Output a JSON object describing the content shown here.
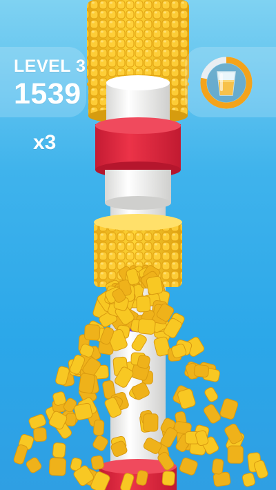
{
  "hud": {
    "level_label": "LEVEL 3",
    "score": "1539",
    "multiplier": "x3"
  },
  "juice_meter": {
    "icon": "juice-glass-icon",
    "fill_fraction": 0.78,
    "ring_color": "#f3a31b",
    "track_color": "#e9eef2"
  },
  "colors": {
    "sky_top": "#7fd2f2",
    "sky_bottom": "#2f9fe3",
    "corn": "#f6c21c",
    "pole": "#f1f1ef",
    "red_ring": "#e3283f",
    "purple_ring": "#6a3fd6"
  }
}
